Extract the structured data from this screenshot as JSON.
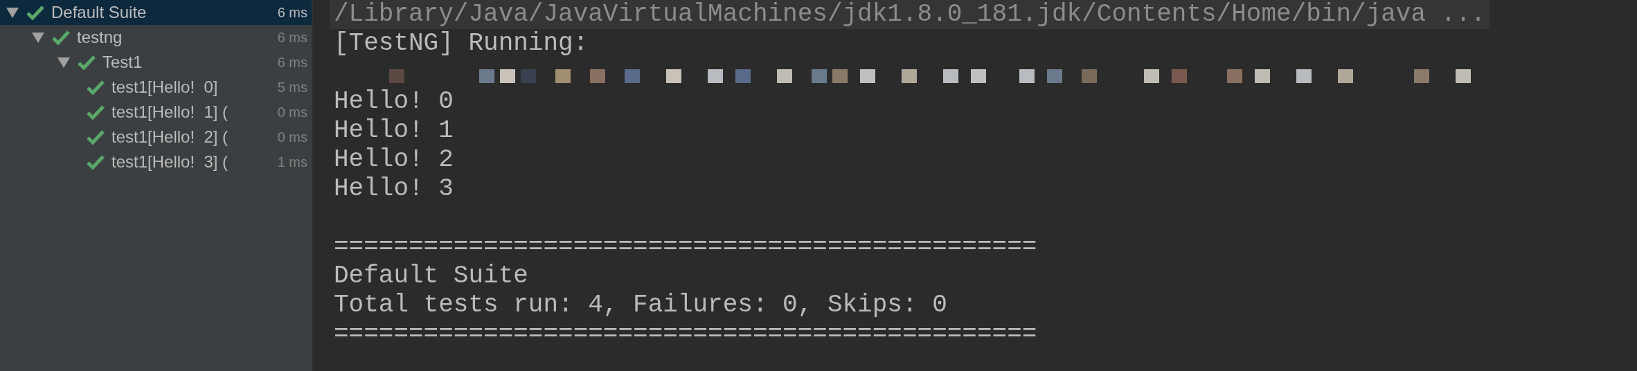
{
  "test_tree": [
    {
      "label": "Default Suite",
      "time": "6 ms",
      "passed": true,
      "expanded": true,
      "selected": true,
      "children": [
        {
          "label": "testng",
          "time": "6 ms",
          "passed": true,
          "expanded": true,
          "selected": false,
          "children": [
            {
              "label": "Test1",
              "time": "6 ms",
              "passed": true,
              "expanded": true,
              "selected": false,
              "children": [
                {
                  "label": "test1[Hello!  0]",
                  "time": "5 ms",
                  "passed": true,
                  "selected": false
                },
                {
                  "label": "test1[Hello!  1] (",
                  "time": "0 ms",
                  "passed": true,
                  "selected": false
                },
                {
                  "label": "test1[Hello!  2] (",
                  "time": "0 ms",
                  "passed": true,
                  "selected": false
                },
                {
                  "label": "test1[Hello!  3] (",
                  "time": "1 ms",
                  "passed": true,
                  "selected": false
                }
              ]
            }
          ]
        }
      ]
    }
  ],
  "console": {
    "command": "/Library/Java/JavaVirtualMachines/jdk1.8.0_181.jdk/Contents/Home/bin/java ...",
    "lines": [
      {
        "kind": "text",
        "text": "[TestNG] Running:"
      },
      {
        "kind": "redacted"
      },
      {
        "kind": "text",
        "text": "Hello! 0"
      },
      {
        "kind": "text",
        "text": "Hello! 1"
      },
      {
        "kind": "text",
        "text": "Hello! 2"
      },
      {
        "kind": "text",
        "text": "Hello! 3"
      },
      {
        "kind": "blank"
      },
      {
        "kind": "text",
        "text": "==============================================="
      },
      {
        "kind": "text",
        "text": "Default Suite"
      },
      {
        "kind": "text",
        "text": "Total tests run: 4, Failures: 0, Skips: 0"
      },
      {
        "kind": "text",
        "text": "==============================================="
      }
    ]
  }
}
